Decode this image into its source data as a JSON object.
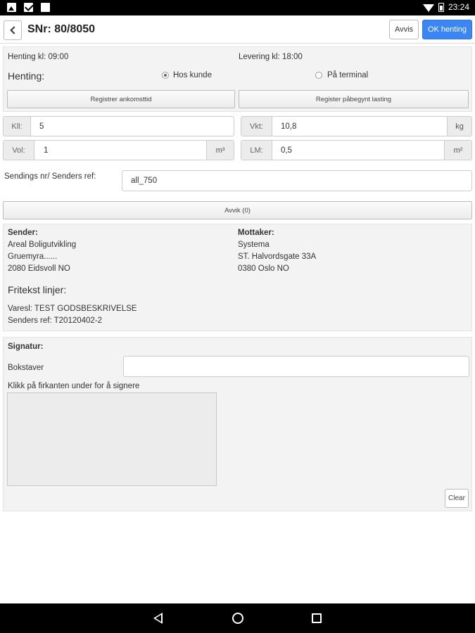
{
  "status_bar": {
    "time": "23:24"
  },
  "header": {
    "title": "SNr: 80/8050",
    "reject_label": "Avvis",
    "ok_label": "OK henting"
  },
  "pickup": {
    "pickup_time": "Henting kl: 09:00",
    "delivery_time": "Levering kl: 18:00",
    "heading": "Henting:",
    "option_customer": "Hos kunde",
    "option_terminal": "På terminal",
    "selected": "Hos kunde",
    "register_arrival": "Registrer ankomsttid",
    "register_loading": "Register påbegynt lasting"
  },
  "fields": {
    "kll_label": "Kll:",
    "kll_value": "5",
    "vkt_label": "Vkt:",
    "vkt_value": "10,8",
    "vkt_unit": "kg",
    "vol_label": "Vol:",
    "vol_value": "1",
    "vol_unit": "m³",
    "lm_label": "LM:",
    "lm_value": "0,5",
    "lm_unit": "m²"
  },
  "senders_ref": {
    "label": "Sendings nr/ Senders ref:",
    "value": "all_750"
  },
  "deviation": {
    "label": "Avvik (0)"
  },
  "parties": {
    "sender_heading": "Sender:",
    "sender_lines": [
      "Areal Boligutvikling",
      "Gruemyra......",
      "2080 Eidsvoll NO"
    ],
    "receiver_heading": "Mottaker:",
    "receiver_lines": [
      "Systema",
      "ST. Halvordsgate 33A",
      "0380 Oslo NO"
    ],
    "freetext_heading": "Fritekst linjer:",
    "freetext_lines": [
      "Varesl: TEST GODSBESKRIVELSE",
      "Senders ref: T20120402-2"
    ]
  },
  "signature": {
    "heading": "Signatur:",
    "letters_label": "Bokstaver",
    "letters_value": "",
    "instruction": "Klikk på firkanten under for å signere",
    "clear_label": "Clear"
  },
  "colors": {
    "accent": "#3b86f5",
    "panel_bg": "#f3f3f3"
  }
}
